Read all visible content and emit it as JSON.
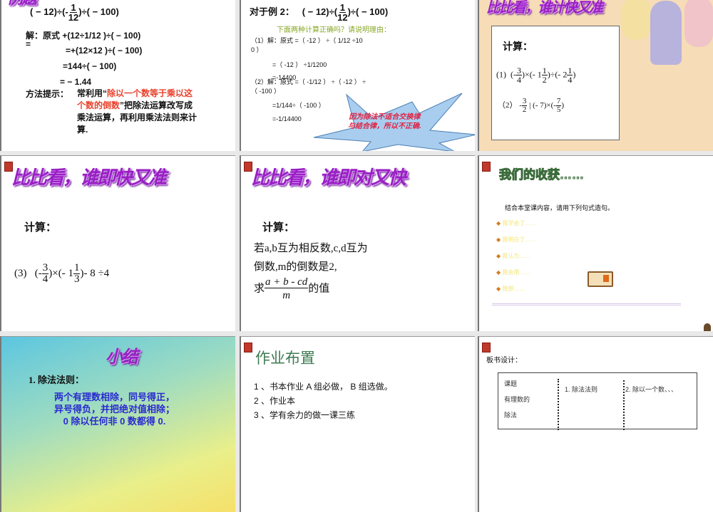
{
  "slides": [
    {
      "expr_left": "( − 12)÷(-",
      "expr_num": "1",
      "expr_den": "12",
      "expr_right": ")÷( − 100)",
      "solution_label": "解：原式",
      "line1": "+(12÷1/12 )÷( − 100)",
      "eq": "=",
      "line2": "=+(12×12 )÷( − 100)",
      "line3": "=144÷( − 100)",
      "line4": "= − 1.44",
      "hint_label": "方法提示：",
      "hint_pre": "常利用“",
      "hint_red_1": "除以一个数等于乘以这",
      "hint_red_2": "个数的倒数",
      "hint_post_1": "”把除法运算改写成",
      "hint_post_2": "乘法运算，再利用乘法法则来计",
      "hint_post_3": "算."
    },
    {
      "title": "对于例 2：",
      "expr_left": "( − 12)÷(",
      "expr_num": "1",
      "expr_den": "12",
      "expr_right": ")÷( − 100)",
      "question": "下面两种计算正确吗？请说明理由：",
      "s1_a": "（1）解：原式 =（ -12 ） ÷（ 1/12 ÷10",
      "s1_b": "0 ）",
      "s1_c": "=（ -12 ） ÷1/1200",
      "s1_d": "=-14400",
      "s2_a": "（2）解：原式 =（ -1/12 ） ÷（ -12 ） ÷",
      "s2_b": "（ -100 ）",
      "s2_c": "=1/144÷（ -100 ）",
      "s2_d": "=-1/14400",
      "callout_1": "因为除法不适合交换律",
      "callout_2": "与结合律，所以不正确."
    },
    {
      "title": "比比看，谁计快又准",
      "calc": "计算：",
      "p1_label": "(1)",
      "p2_label": "（2）"
    },
    {
      "title": "比比看，谁即快又准",
      "calc": "计算：",
      "p3_label": "(3)",
      "p3_tail": "- 8 ÷4"
    },
    {
      "title": "比比看，谁即对又快",
      "calc": "计算：",
      "line1": "若a,b互为相反数,c,d互为",
      "line2": "倒数,m的倒数是2,",
      "line3_pre": "求",
      "num": "a + b - cd",
      "den": "m",
      "line3_post": "的值"
    },
    {
      "title": "我们的收获……",
      "intro": "结合本堂课内容，请用下列句式造句。",
      "bullets": [
        "我学会了……",
        "我明白了……",
        "我认为……",
        "我会用……",
        "我想……"
      ]
    },
    {
      "title": "小结",
      "rule_label": "1. 除法法则：",
      "rule_1": "两个有理数相除，同号得正，",
      "rule_2": "异号得负，并把绝对值相除；",
      "rule_3": "0 除以任何非 0 数都得 0."
    },
    {
      "title": "作业布置",
      "items": [
        "1 、书本作业 A 组必做， B 组选做。",
        "2 、作业本",
        "3 、学有余力的做一课三练"
      ]
    },
    {
      "title": "板书设计：",
      "cell1_a": "课题",
      "cell1_b": "有理数的",
      "cell1_c": "除法",
      "cell2": "1. 除法法则",
      "cell3": "2. 除以一个数、、、"
    }
  ]
}
